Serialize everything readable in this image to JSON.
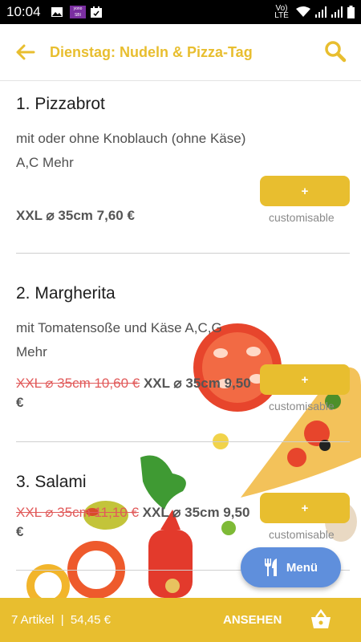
{
  "status_bar": {
    "time": "10:04",
    "carrier_badge": "yono SBI",
    "network": "Vo) LTE"
  },
  "header": {
    "title": "Dienstag: Nudeln & Pizza-Tag",
    "back_icon": "arrow-left-icon",
    "search_icon": "search-icon"
  },
  "menu_items": [
    {
      "name": "1. Pizzabrot",
      "description": "mit oder ohne Knoblauch (ohne Käse) A,C Mehr",
      "old_price": "",
      "price": "XXL ⌀ 35cm 7,60 €",
      "add_label": "+",
      "customisable": "customisable"
    },
    {
      "name": "2. Margherita",
      "description": "mit Tomatensoße und Käse A,C,G Mehr",
      "old_price": "XXL ⌀ 35cm 10,60 €",
      "price": "XXL ⌀ 35cm 9,50 €",
      "add_label": "+",
      "customisable": "customisable"
    },
    {
      "name": "3. Salami",
      "description": "",
      "old_price": "XXL ⌀ 35cm 11,10 €",
      "price": "XXL ⌀ 35cm 9,50 €",
      "add_label": "+",
      "customisable": "customisable"
    }
  ],
  "fab": {
    "label": "Menü",
    "icon": "cutlery-icon"
  },
  "cart": {
    "summary": "7 Artikel  |  54,45 €",
    "view_label": "ANSEHEN",
    "icon": "basket-icon"
  },
  "colors": {
    "accent": "#e8be2f",
    "fab": "#5f8fdc",
    "strike": "#e15a5a"
  }
}
